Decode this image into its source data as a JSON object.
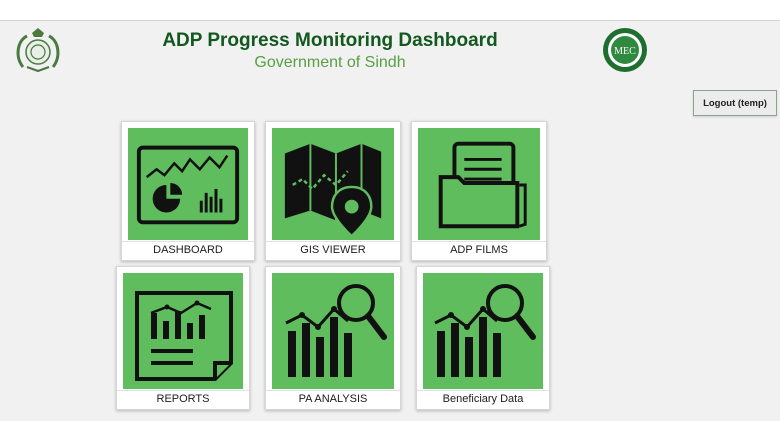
{
  "header": {
    "title": "ADP Progress Monitoring Dashboard",
    "subtitle": "Government of Sindh",
    "left_logo": "sindh-government-seal-icon",
    "right_logo_text": "MEC"
  },
  "actions": {
    "logout_label": "Logout (temp)"
  },
  "tiles": [
    {
      "label": "DASHBOARD",
      "icon": "dashboard-chart-icon"
    },
    {
      "label": "GIS VIEWER",
      "icon": "map-pin-icon"
    },
    {
      "label": "ADP FILMS",
      "icon": "folder-icon"
    },
    {
      "label": "REPORTS",
      "icon": "report-document-icon"
    },
    {
      "label": "PA ANALYSIS",
      "icon": "analysis-magnifier-icon"
    },
    {
      "label": "Beneficiary Data",
      "icon": "data-magnifier-icon"
    }
  ],
  "colors": {
    "tile_green": "#5fbd5e",
    "title_green": "#12581f",
    "subtitle_green": "#58a043"
  }
}
